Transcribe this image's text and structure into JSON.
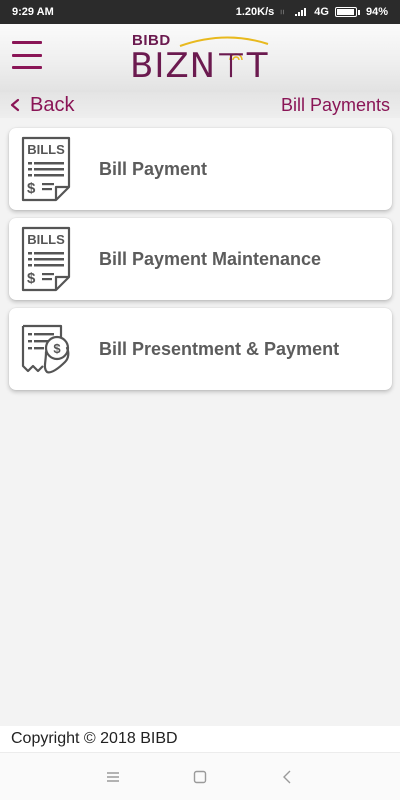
{
  "status_bar": {
    "time": "9:29 AM",
    "network_speed": "1.20K/s",
    "network_type": "4G",
    "battery": "94%",
    "battery_level": 0.94
  },
  "header": {
    "logo_top": "BIBD",
    "logo_main": "BIZN⊤T",
    "brand_color": "#8a1556"
  },
  "nav": {
    "back_label": "Back",
    "page_title": "Bill Payments"
  },
  "cards": [
    {
      "label": "Bill Payment",
      "icon": "bills-icon"
    },
    {
      "label": "Bill Payment Maintenance",
      "icon": "bills-icon"
    },
    {
      "label": "Bill Presentment & Payment",
      "icon": "receipt-dollar-icon"
    }
  ],
  "bills_icon_text": "BILLS",
  "footer": {
    "copyright": "Copyright © 2018 BIBD"
  }
}
